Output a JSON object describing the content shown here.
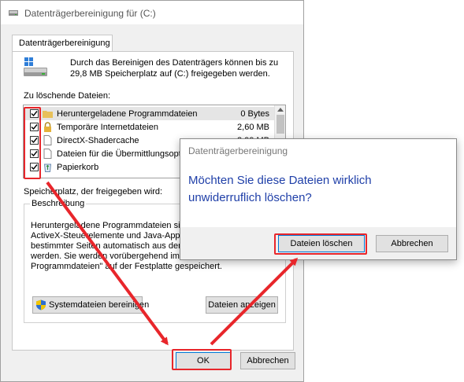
{
  "main_window": {
    "title": "Datenträgerbereinigung für  (C:)",
    "tab_label": "Datenträgerbereinigung",
    "intro_line1": "Durch das Bereinigen des Datenträgers können bis zu",
    "intro_line2": "29,8 MB Speicherplatz auf  (C:) freigegeben werden.",
    "files_label": "Zu löschende Dateien:",
    "files": [
      {
        "name": "Heruntergeladene Programmdateien",
        "size": "0 Bytes",
        "checked": true,
        "icon": "folder-icon"
      },
      {
        "name": "Temporäre Internetdateien",
        "size": "2,60 MB",
        "checked": true,
        "icon": "lock-icon"
      },
      {
        "name": "DirectX-Shadercache",
        "size": "2,99 MB",
        "checked": true,
        "icon": "file-icon"
      },
      {
        "name": "Dateien für die Übermittlungsoptim",
        "size": "",
        "checked": true,
        "icon": "file-icon"
      },
      {
        "name": "Papierkorb",
        "size": "",
        "checked": true,
        "icon": "recycle-bin-icon"
      }
    ],
    "space_label": "Speicherplatz, der freigegeben wird:",
    "description_legend": "Beschreibung",
    "description_lines": [
      "Heruntergeladene Programmdateien sin",
      "ActiveX-Steuerelemente und Java-Apple",
      "bestimmter Seiten automatisch aus dem",
      "werden. Sie werden vorübergehend im O",
      "Programmdateien\" auf der Festplatte gespeichert."
    ],
    "button_system_files": "Systemdateien bereinigen",
    "button_show_files": "Dateien anzeigen",
    "button_ok": "OK",
    "button_cancel": "Abbrechen"
  },
  "confirm_dialog": {
    "title": "Datenträgerbereinigung",
    "message": "Möchten Sie diese Dateien wirklich unwiderruflich löschen?",
    "button_delete": "Dateien löschen",
    "button_cancel": "Abbrechen"
  },
  "colors": {
    "annotation_red": "#e8262b",
    "message_blue": "#1f3fa8",
    "focus_blue": "#0078d7"
  }
}
